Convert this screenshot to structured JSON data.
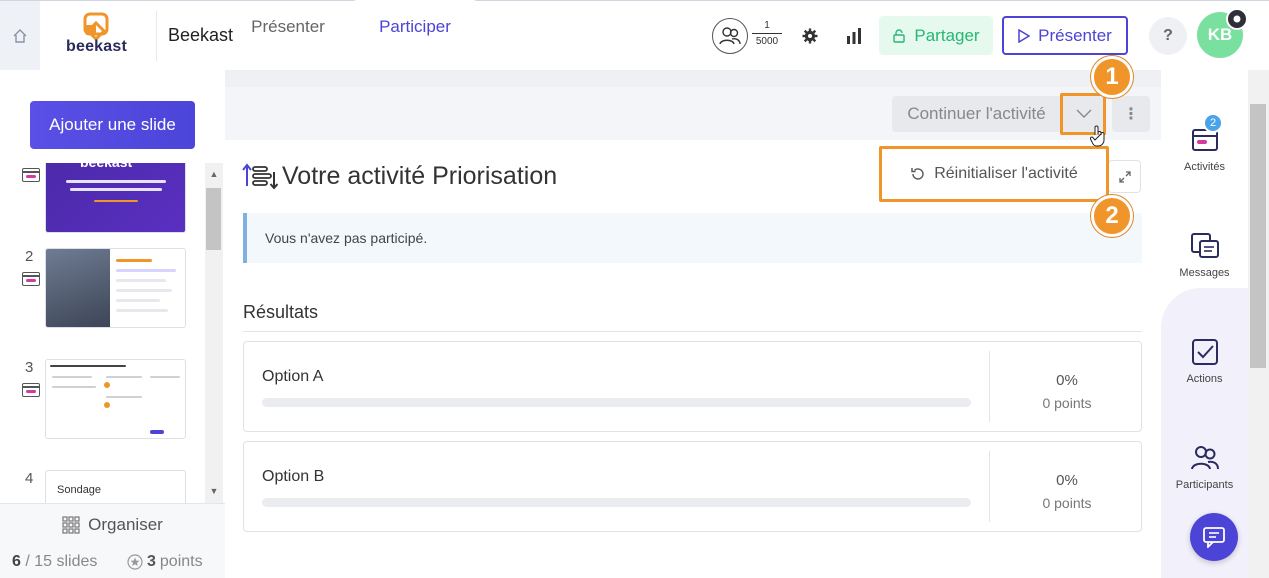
{
  "header": {
    "app_name": "Beekast",
    "logo_text": "beekast",
    "participants_current": "1",
    "participants_max": "5000",
    "share_label": "Partager",
    "present_label": "Présenter",
    "help_label": "?",
    "avatar_initials": "KB"
  },
  "sidebar": {
    "add_slide_label": "Ajouter une slide",
    "slides": [
      {
        "number": "",
        "thumb_title": "beekast"
      },
      {
        "number": "2",
        "thumb_title": ""
      },
      {
        "number": "3",
        "thumb_title": ""
      },
      {
        "number": "4",
        "thumb_title": "Sondage"
      }
    ],
    "organize_label": "Organiser",
    "current_slide": "6",
    "total_slides": "/ 15 slides",
    "points": "3",
    "points_label": "points"
  },
  "main": {
    "tabs": [
      {
        "label": "Présenter",
        "active": false
      },
      {
        "label": "Participer",
        "active": true
      }
    ],
    "continue_label": "Continuer l'activité",
    "more_label": "⋮",
    "activity_title": "Votre activité Priorisation",
    "reset_label": "Réinitialiser l'activité",
    "notice": "Vous n'avez pas participé.",
    "results_title": "Résultats",
    "options": [
      {
        "label": "Option A",
        "percent": "0%",
        "points": "0 points",
        "fill": 0
      },
      {
        "label": "Option B",
        "percent": "0%",
        "points": "0 points",
        "fill": 0
      }
    ]
  },
  "annotations": [
    {
      "number": "1",
      "color": "#f0952a"
    },
    {
      "number": "2",
      "color": "#f0952a"
    }
  ],
  "right_sidebar": {
    "items": [
      {
        "label": "Activités",
        "badge": "2"
      },
      {
        "label": "Messages"
      },
      {
        "label": "Actions"
      },
      {
        "label": "Participants"
      }
    ]
  },
  "colors": {
    "accent": "#4c44d6",
    "share": "#2ab673",
    "avatar": "#79e09f",
    "annotation": "#f0952a"
  }
}
